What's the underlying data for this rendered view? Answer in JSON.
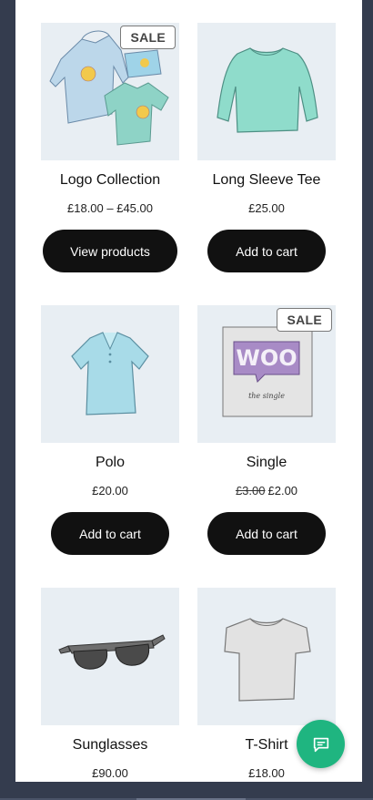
{
  "products": [
    {
      "title": "Logo Collection",
      "price": "£18.00 – £45.00",
      "old_price": "",
      "button": "View products",
      "sale_badge": "SALE"
    },
    {
      "title": "Long Sleeve Tee",
      "price": "£25.00",
      "old_price": "",
      "button": "Add to cart",
      "sale_badge": ""
    },
    {
      "title": "Polo",
      "price": "£20.00",
      "old_price": "",
      "button": "Add to cart",
      "sale_badge": ""
    },
    {
      "title": "Single",
      "price": "£2.00",
      "old_price": "£3.00",
      "button": "Add to cart",
      "sale_badge": "SALE"
    },
    {
      "title": "Sunglasses",
      "price": "£90.00",
      "old_price": "",
      "button": "",
      "sale_badge": ""
    },
    {
      "title": "T-Shirt",
      "price": "£18.00",
      "old_price": "",
      "button": "",
      "sale_badge": ""
    }
  ],
  "album_art": {
    "logo_text": "WOO",
    "caption": "the single"
  },
  "chat": {
    "icon": "chat-bubble-icon"
  },
  "colors": {
    "background": "#343c4e",
    "button": "#111111",
    "chat_fab": "#1fb580",
    "thumb_bg": "#e8eef3"
  }
}
